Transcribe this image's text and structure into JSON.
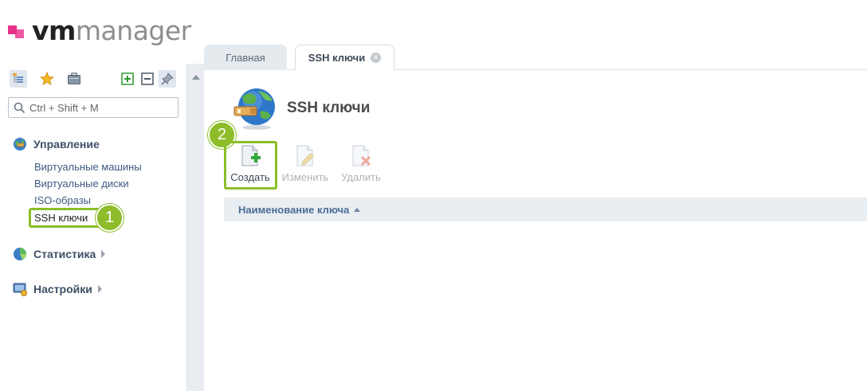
{
  "logo": {
    "part1": "vm",
    "part2": "manager"
  },
  "sidebar": {
    "toolbar": [
      {
        "icon": "tree-icon"
      },
      {
        "icon": "star-icon"
      },
      {
        "icon": "briefcase-icon"
      },
      {
        "icon": "expand-plus-icon"
      },
      {
        "icon": "collapse-minus-icon"
      },
      {
        "icon": "pin-icon"
      }
    ],
    "search": {
      "placeholder": "Ctrl + Shift + M",
      "value": ""
    },
    "groups": {
      "management": {
        "title": "Управление",
        "items": [
          "Виртуальные машины",
          "Виртуальные диски",
          "ISO-образы",
          "SSH ключи"
        ]
      },
      "statistics": {
        "title": "Статистика"
      },
      "settings": {
        "title": "Настройки"
      }
    }
  },
  "badges": {
    "first": "1",
    "second": "2"
  },
  "tabs": {
    "home": "Главная",
    "ssh": "SSH ключи"
  },
  "page": {
    "title": "SSH ключи"
  },
  "toolbar": {
    "create": "Создать",
    "edit": "Изменить",
    "delete": "Удалить"
  },
  "grid": {
    "columns": [
      "Наименование ключа"
    ]
  },
  "colors": {
    "accent_green": "#8dbd2a",
    "brand_pink": "#e8318a",
    "link_blue": "#3d5a80"
  }
}
